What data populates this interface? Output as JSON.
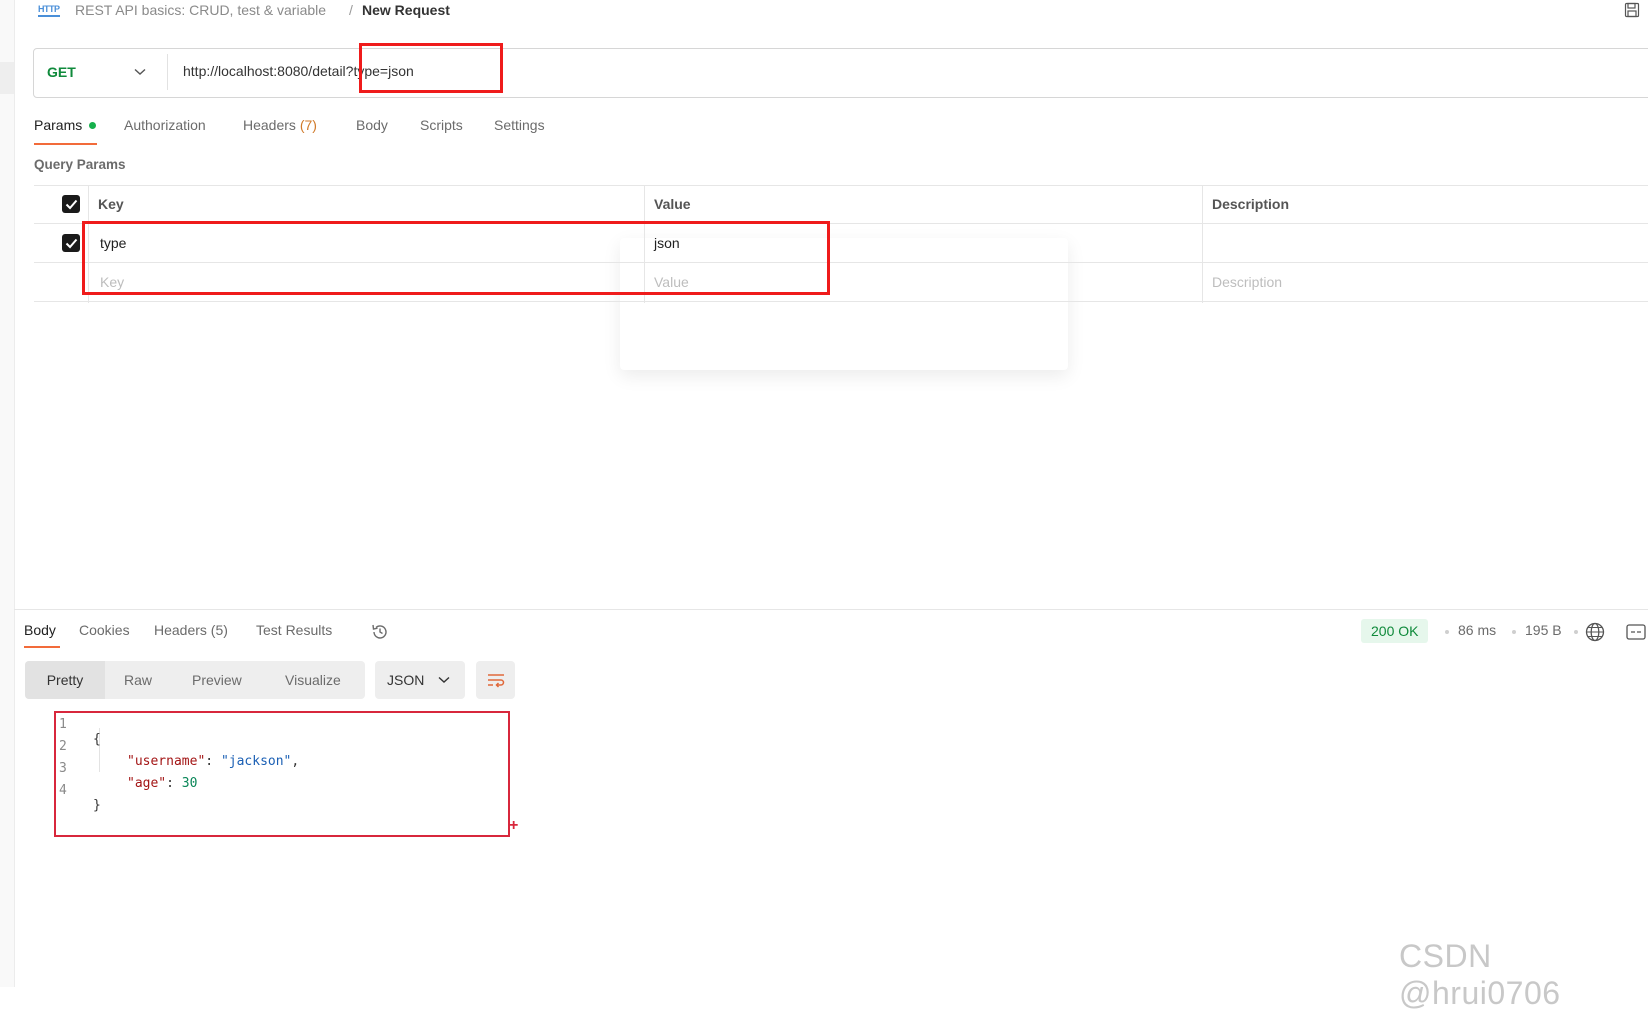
{
  "breadcrumb": {
    "badge": "HTTP",
    "collection": "REST API basics: CRUD, test & variable",
    "separator": "/",
    "current": "New Request"
  },
  "request": {
    "method": "GET",
    "url": "http://localhost:8080/detail?type=json"
  },
  "request_tabs": [
    {
      "label": "Params",
      "count": ""
    },
    {
      "label": "Authorization",
      "count": ""
    },
    {
      "label": "Headers",
      "count": "(7)"
    },
    {
      "label": "Body",
      "count": ""
    },
    {
      "label": "Scripts",
      "count": ""
    },
    {
      "label": "Settings",
      "count": ""
    }
  ],
  "query_params": {
    "title": "Query Params",
    "headers": {
      "key": "Key",
      "value": "Value",
      "description": "Description"
    },
    "rows": [
      {
        "key": "type",
        "value": "json",
        "description": "",
        "checked": true
      }
    ],
    "placeholders": {
      "key": "Key",
      "value": "Value",
      "description": "Description"
    }
  },
  "response": {
    "tabs": [
      {
        "label": "Body"
      },
      {
        "label": "Cookies"
      },
      {
        "label": "Headers (5)"
      },
      {
        "label": "Test Results"
      }
    ],
    "status": "200 OK",
    "time": "86 ms",
    "size": "195 B",
    "view_modes": [
      "Pretty",
      "Raw",
      "Preview",
      "Visualize"
    ],
    "format": "JSON",
    "body_lines": [
      {
        "n": "1",
        "text": "{"
      },
      {
        "n": "2",
        "key": "\"username\"",
        "colon": ": ",
        "val": "\"jackson\"",
        "tail": ","
      },
      {
        "n": "3",
        "key": "\"age\"",
        "colon": ": ",
        "num": "30",
        "tail": ""
      },
      {
        "n": "4",
        "text": "}"
      }
    ]
  },
  "watermark": "CSDN @hrui0706",
  "colors": {
    "accent": "#f26b3a",
    "method": "#0f8a3b",
    "status_ok": "#0f8a3b",
    "annotation": "#ef1b1b"
  }
}
